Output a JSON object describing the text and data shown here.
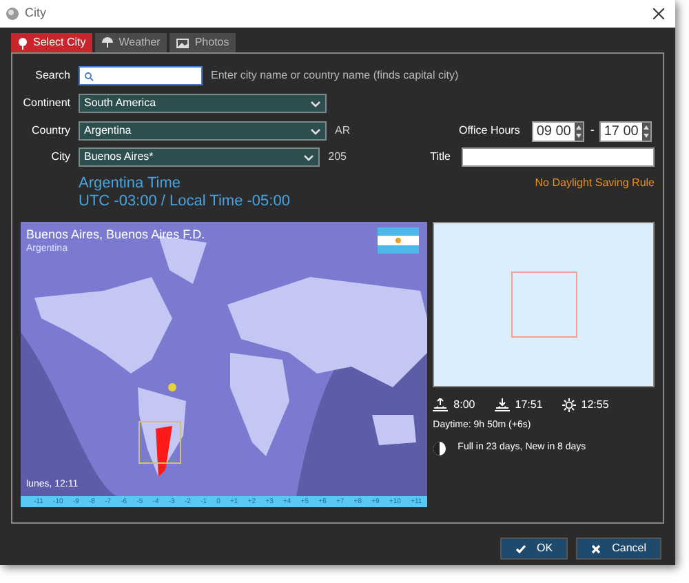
{
  "window": {
    "title": "City"
  },
  "tabs": [
    {
      "label": "Select City",
      "selected": true
    },
    {
      "label": "Weather",
      "selected": false
    },
    {
      "label": "Photos",
      "selected": false
    }
  ],
  "search": {
    "label": "Search",
    "hint": "Enter city name or country name (finds capital city)"
  },
  "continent": {
    "label": "Continent",
    "value": "South America"
  },
  "country": {
    "label": "Country",
    "value": "Argentina",
    "code": "AR"
  },
  "city": {
    "label": "City",
    "value": "Buenos Aires*",
    "code": "205"
  },
  "office_hours": {
    "label": "Office Hours",
    "start": "09 00",
    "separator": "-",
    "end": "17 00"
  },
  "title_field": {
    "label": "Title"
  },
  "dst_note": "No Daylight Saving Rule",
  "time_info": {
    "zone": "Argentina Time",
    "offsets": "UTC -03:00 / Local Time -05:00"
  },
  "map": {
    "city": "Buenos Aires, Buenos Aires F.D.",
    "country": "Argentina",
    "local_time": "lunes, 12:11",
    "scale": [
      "-11",
      "-10",
      "-9",
      "-8",
      "-7",
      "-6",
      "-5",
      "-4",
      "-3",
      "-2",
      "-1",
      "0",
      "+1",
      "+2",
      "+3",
      "+4",
      "+5",
      "+6",
      "+7",
      "+8",
      "+9",
      "+10",
      "+11"
    ]
  },
  "sun": {
    "sunrise": "8:00",
    "sunset": "17:51",
    "noon": "12:55",
    "daytime": "Daytime: 9h 50m (+6s)"
  },
  "moon": {
    "text": "Full in 23 days, New in 8 days"
  },
  "buttons": [
    {
      "label": "OK",
      "kind": "ok"
    },
    {
      "label": "Cancel",
      "kind": "cancel"
    }
  ]
}
